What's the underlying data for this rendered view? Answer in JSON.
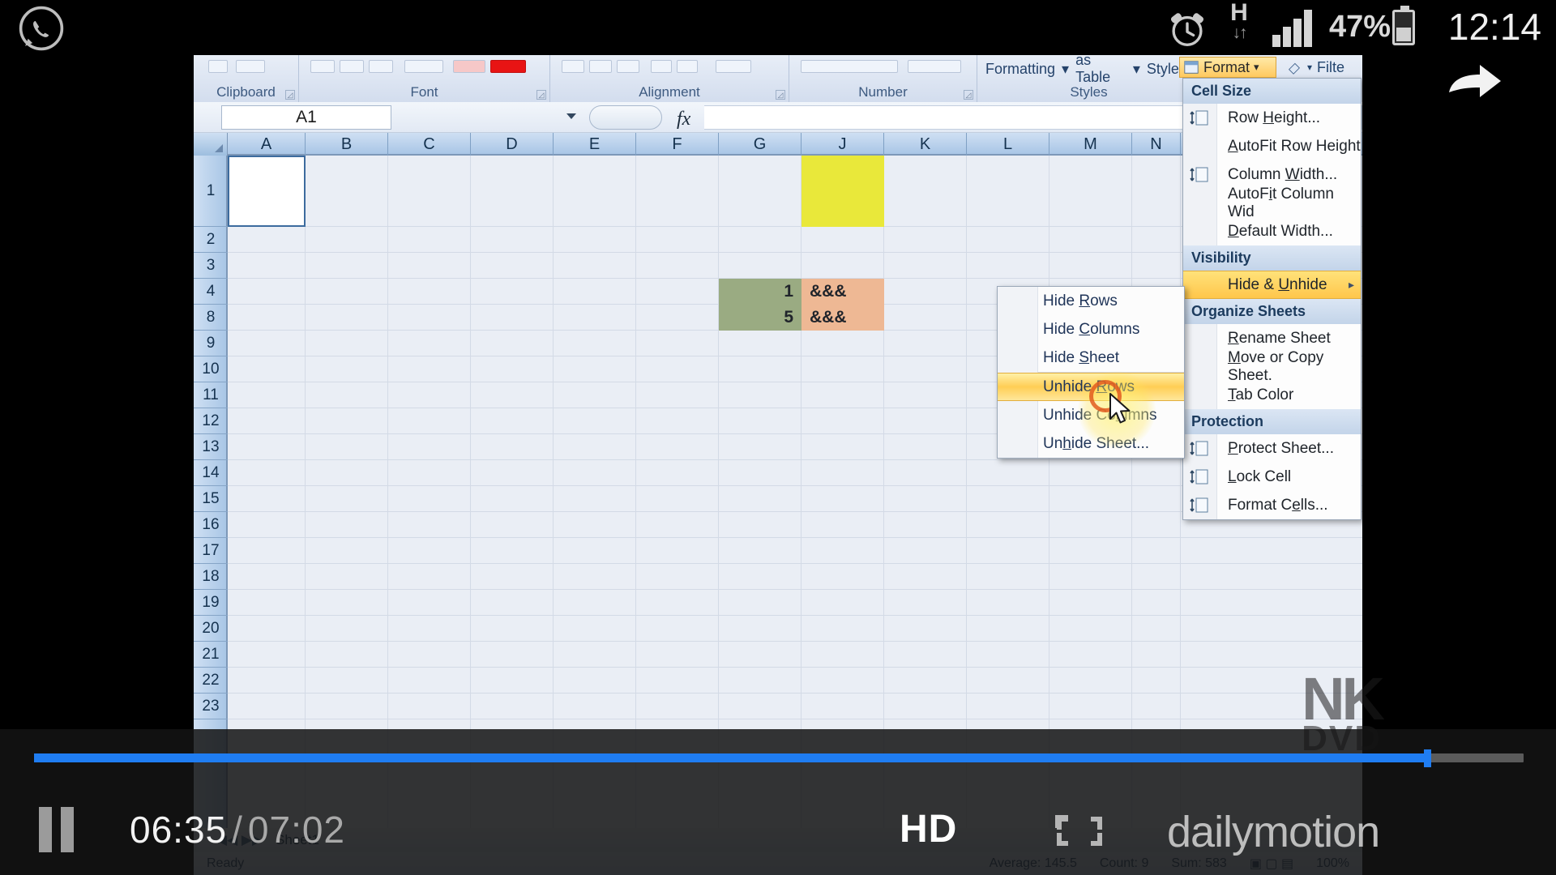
{
  "status_bar": {
    "whatsapp_icon": "whatsapp-icon",
    "alarm_icon": "alarm-clock-icon",
    "network_type": "H",
    "data_arrows": "↓↑",
    "signal_icon": "signal-bars-icon",
    "battery_percent": "47%",
    "battery_icon": "battery-icon",
    "clock": "12:14"
  },
  "excel": {
    "ribbon_groups": [
      {
        "label": "Clipboard"
      },
      {
        "label": "Font"
      },
      {
        "label": "Alignment"
      },
      {
        "label": "Number"
      },
      {
        "label": "Styles"
      }
    ],
    "styles_buttons": [
      "Formatting",
      "as Table",
      "Styles"
    ],
    "formula_bar": {
      "name_box": "A1",
      "fx_symbol": "fx",
      "formula_value": ""
    },
    "column_headers": [
      "A",
      "B",
      "C",
      "D",
      "E",
      "F",
      "G",
      "J",
      "K",
      "L",
      "M",
      "N"
    ],
    "row_headers": [
      "1",
      "2",
      "3",
      "4",
      "8",
      "9",
      "10",
      "11",
      "12",
      "13",
      "14",
      "15",
      "16",
      "17",
      "18",
      "19",
      "20",
      "21",
      "22",
      "23"
    ],
    "cells": [
      {
        "ref": "J1",
        "value": "",
        "fill": "#e9e83a"
      },
      {
        "ref": "G4",
        "value": "1",
        "fill": "#9aab82",
        "align": "right"
      },
      {
        "ref": "J4",
        "value": "&&&",
        "fill": "#eeb894",
        "align": "left"
      },
      {
        "ref": "G8",
        "value": "5",
        "fill": "#9aab82",
        "align": "right"
      },
      {
        "ref": "J8",
        "value": "&&&",
        "fill": "#eeb894",
        "align": "left"
      }
    ],
    "active_cell": "A1",
    "sheet_tabs": [
      "Sheet1"
    ],
    "status_left": "Ready",
    "status_right": [
      "Average: 145.5",
      "Count: 9",
      "Sum: 583",
      "100%"
    ],
    "format_button": {
      "label": "Format",
      "icon": "format-icon",
      "caret": "▾"
    },
    "fill_button": {
      "label": "Filte",
      "icon": "fill-color-icon",
      "caret": "▾"
    },
    "format_menu": {
      "sections": [
        {
          "title": "Cell Size",
          "items": [
            {
              "label": "Row Height...",
              "accel": "H",
              "icon": "row-height-icon"
            },
            {
              "label": "AutoFit Row Height",
              "accel": "A",
              "icon": ""
            },
            {
              "label": "Column Width...",
              "accel": "W",
              "icon": "column-width-icon"
            },
            {
              "label": "AutoFit Column Wid",
              "accel": "i",
              "icon": ""
            },
            {
              "label": "Default Width...",
              "accel": "D",
              "icon": ""
            }
          ]
        },
        {
          "title": "Visibility",
          "items": [
            {
              "label": "Hide & Unhide",
              "accel": "U",
              "icon": "",
              "highlighted": true,
              "submenu": true
            }
          ]
        },
        {
          "title": "Organize Sheets",
          "items": [
            {
              "label": "Rename Sheet",
              "accel": "R",
              "icon": ""
            },
            {
              "label": "Move or Copy Sheet.",
              "accel": "M",
              "icon": ""
            },
            {
              "label": "Tab Color",
              "accel": "T",
              "icon": ""
            }
          ]
        },
        {
          "title": "Protection",
          "items": [
            {
              "label": "Protect Sheet...",
              "accel": "P",
              "icon": "protect-sheet-icon"
            },
            {
              "label": "Lock Cell",
              "accel": "L",
              "icon": "lock-cell-icon"
            },
            {
              "label": "Format Cells...",
              "accel": "e",
              "icon": "format-cells-icon"
            }
          ]
        }
      ]
    },
    "hide_unhide_submenu": {
      "items": [
        {
          "label": "Hide Rows",
          "accel": "R",
          "highlighted": false
        },
        {
          "label": "Hide Columns",
          "accel": "C",
          "highlighted": false
        },
        {
          "label": "Hide Sheet",
          "accel": "S",
          "highlighted": false
        },
        {
          "label": "Unhide Rows",
          "accel": "R",
          "highlighted": true
        },
        {
          "label": "Unhide Columns",
          "accel": "l",
          "highlighted": false
        },
        {
          "label": "Unhide Sheet...",
          "accel": "h",
          "highlighted": false
        }
      ]
    }
  },
  "player": {
    "pause_button": "pause-button",
    "current_time": "06:35",
    "separator": "/",
    "total_time": "07:02",
    "quality_badge": "HD",
    "fullscreen_icon": "fullscreen-icon",
    "brand": "dailymotion",
    "progress_percent": 93.5,
    "share_icon": "share-icon"
  },
  "watermark": {
    "line1": "NK",
    "line2": "DVD"
  }
}
